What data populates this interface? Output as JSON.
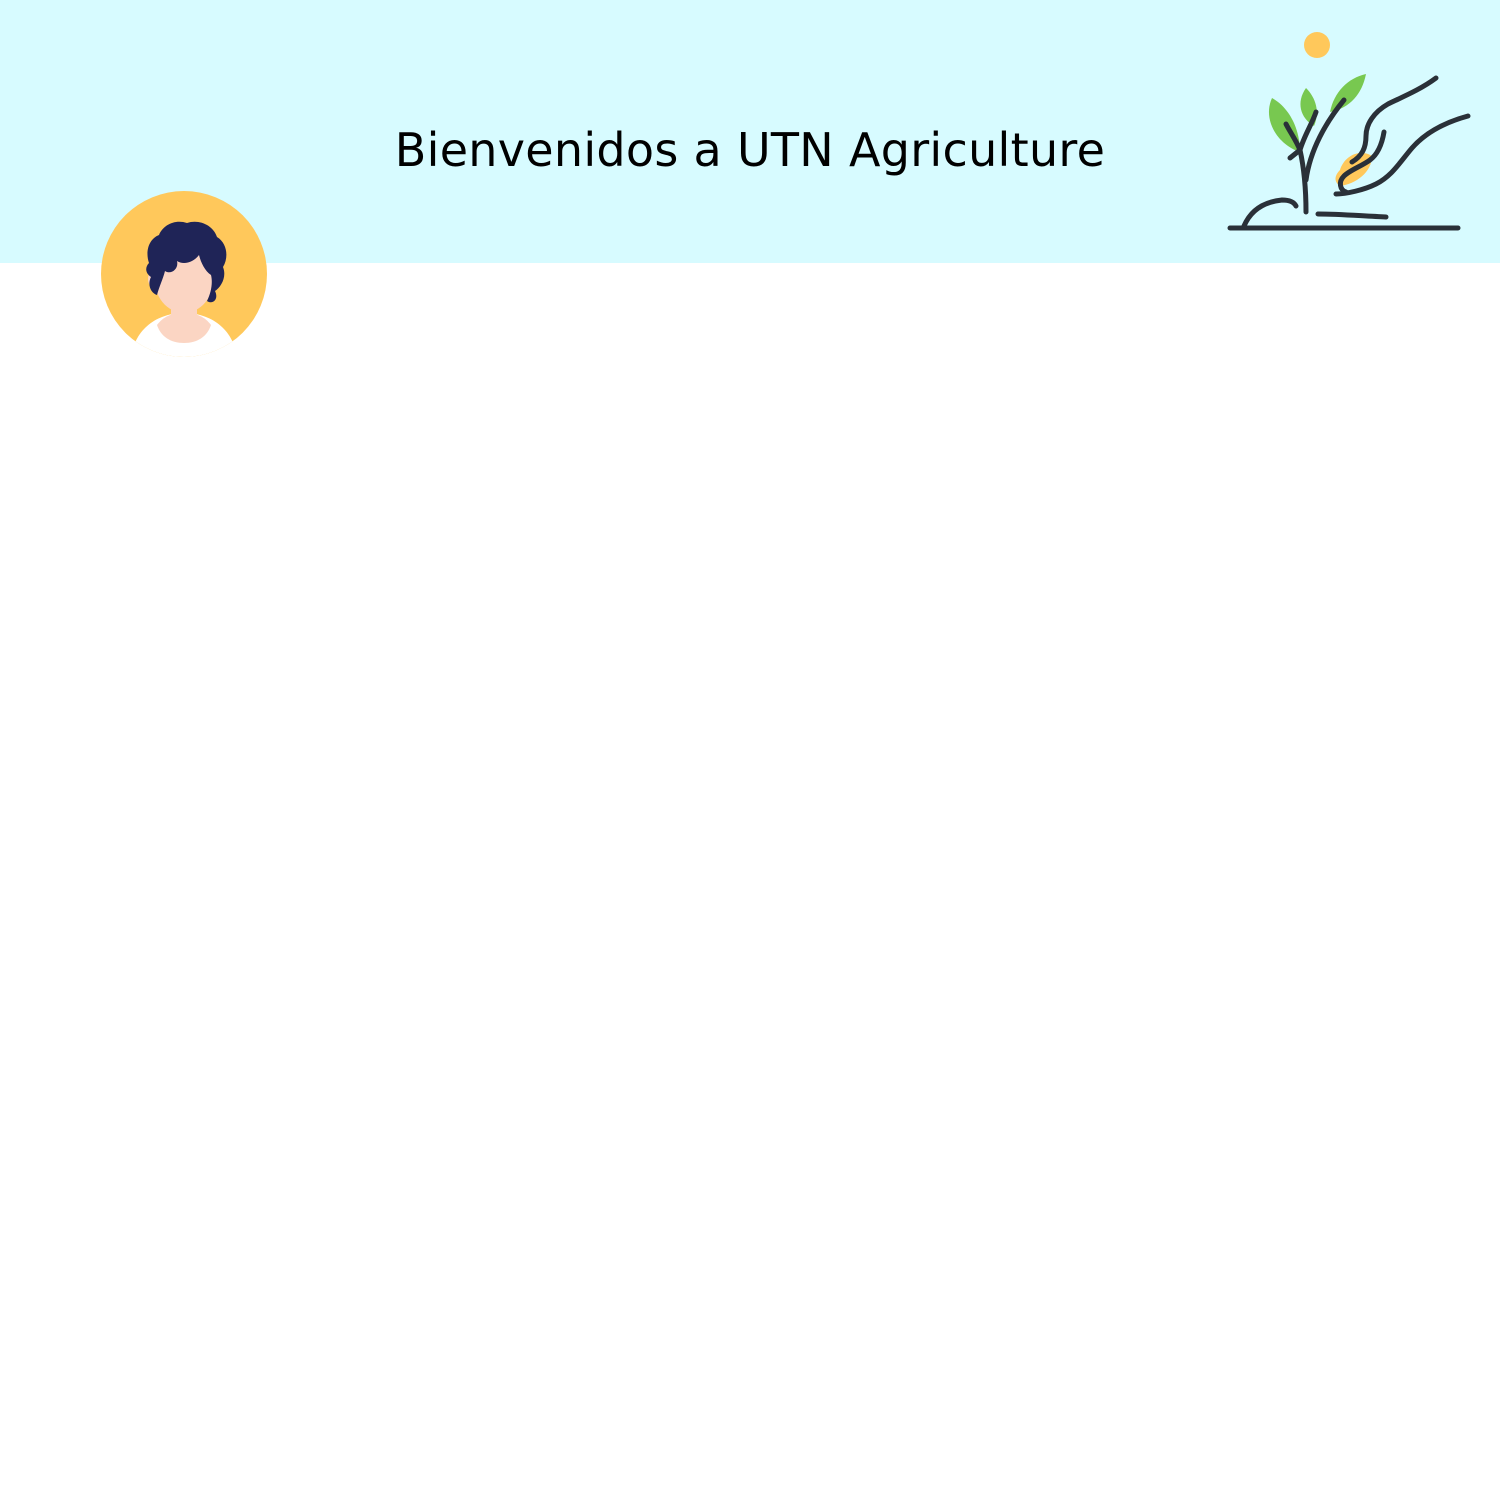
{
  "header": {
    "title": "Bienvenidos a UTN Agriculture",
    "background_color": "#d7fbff",
    "logo_icon": "plant-hand-icon"
  },
  "user": {
    "avatar_icon": "user-avatar-icon",
    "avatar_background": "#ffc85b"
  }
}
